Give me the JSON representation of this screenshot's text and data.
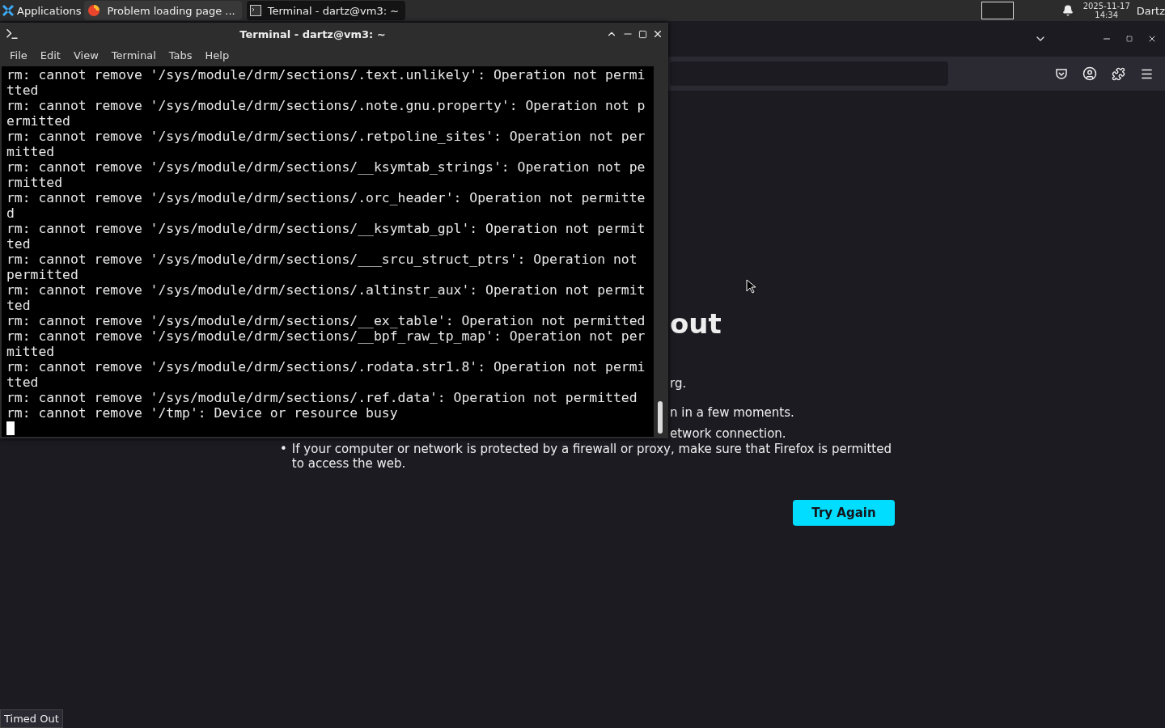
{
  "panel": {
    "menu": "Applications",
    "tasks": [
      {
        "label": "Problem loading page ...",
        "kind": "browser",
        "selected": false
      },
      {
        "label": "Terminal - dartz@vm3: ~",
        "kind": "terminal",
        "selected": true
      }
    ],
    "date": "2025-11-17",
    "time": "14:34",
    "user": "Dartz"
  },
  "browser": {
    "heading": "out",
    "intro": "rg.",
    "bullets": [
      "n in a few moments.",
      "etwork connection."
    ],
    "bullet_mark": "•",
    "bullet_full": "If your computer or network is protected by a firewall or proxy, make sure that Firefox is permitted to access the web.",
    "button": "Try Again",
    "status": "Timed Out"
  },
  "terminal": {
    "title": "Terminal - dartz@vm3: ~",
    "menu": [
      "File",
      "Edit",
      "View",
      "Terminal",
      "Tabs",
      "Help"
    ],
    "lines": [
      "rm: cannot remove '/sys/module/drm/sections/.text.unlikely': Operation not permi",
      "tted",
      "rm: cannot remove '/sys/module/drm/sections/.note.gnu.property': Operation not p",
      "ermitted",
      "rm: cannot remove '/sys/module/drm/sections/.retpoline_sites': Operation not per",
      "mitted",
      "rm: cannot remove '/sys/module/drm/sections/__ksymtab_strings': Operation not pe",
      "rmitted",
      "rm: cannot remove '/sys/module/drm/sections/.orc_header': Operation not permitte",
      "d",
      "rm: cannot remove '/sys/module/drm/sections/__ksymtab_gpl': Operation not permit",
      "ted",
      "rm: cannot remove '/sys/module/drm/sections/___srcu_struct_ptrs': Operation not",
      "permitted",
      "rm: cannot remove '/sys/module/drm/sections/.altinstr_aux': Operation not permit",
      "ted",
      "rm: cannot remove '/sys/module/drm/sections/__ex_table': Operation not permitted",
      "rm: cannot remove '/sys/module/drm/sections/__bpf_raw_tp_map': Operation not per",
      "mitted",
      "rm: cannot remove '/sys/module/drm/sections/.rodata.str1.8': Operation not permi",
      "tted",
      "rm: cannot remove '/sys/module/drm/sections/.ref.data': Operation not permitted",
      "rm: cannot remove '/tmp': Device or resource busy"
    ]
  }
}
